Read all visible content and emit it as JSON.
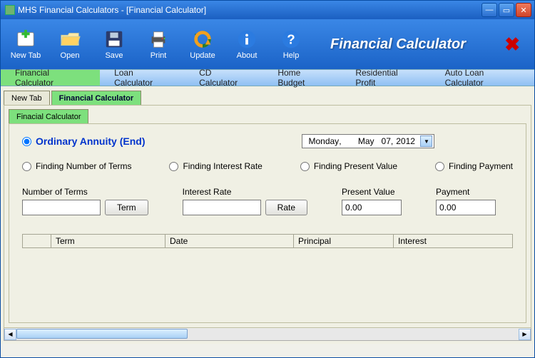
{
  "window": {
    "title": "MHS Financial Calculators - [Financial Calculator]"
  },
  "toolbar": {
    "newtab": "New Tab",
    "open": "Open",
    "save": "Save",
    "print": "Print",
    "update": "Update",
    "about": "About",
    "help": "Help",
    "brand": "Financial Calculator"
  },
  "menu": {
    "fincalc": "Financial Calculator",
    "loan": "Loan Calculator",
    "cd": "CD Calculator",
    "budget": "Home Budget",
    "profit": "Residential Profit",
    "autoloan": "Auto Loan Calculator"
  },
  "doctabs": {
    "newtab": "New Tab",
    "fincalc": "Financial Calculator"
  },
  "subtab": {
    "label": "Finacial Calculator"
  },
  "form": {
    "annuity_label": "Ordinary Annuity (End)",
    "date": {
      "weekday": "Monday",
      "month": "May",
      "day": "07,",
      "year": "2012",
      "sep": ", "
    },
    "find_terms": "Finding Number of Terms",
    "find_rate": "Finding Interest Rate",
    "find_pv": "Finding Present Value",
    "find_pay": "Finding Payment",
    "fld_terms": "Number of Terms",
    "fld_rate": "Interest Rate",
    "fld_pv": "Present Value",
    "fld_pay": "Payment",
    "btn_term": "Term",
    "btn_rate": "Rate",
    "val_terms": "",
    "val_rate": "",
    "val_pv": "0.00",
    "val_pay": "0.00"
  },
  "table": {
    "term": "Term",
    "date": "Date",
    "principal": "Principal",
    "interest": "Interest"
  }
}
